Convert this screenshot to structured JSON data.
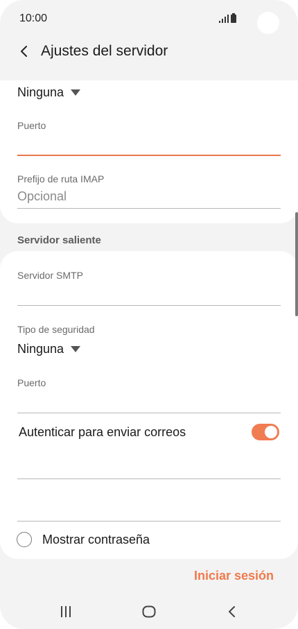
{
  "status_bar": {
    "time": "10:00"
  },
  "app_bar": {
    "title": "Ajustes del servidor"
  },
  "incoming": {
    "security_value": "Ninguna",
    "port_label": "Puerto",
    "port_value": "",
    "imap_prefix_label": "Prefijo de ruta IMAP",
    "imap_prefix_placeholder": "Opcional"
  },
  "outgoing": {
    "section_title": "Servidor saliente",
    "smtp_label": "Servidor SMTP",
    "smtp_value": "",
    "security_type_label": "Tipo de seguridad",
    "security_value": "Ninguna",
    "port_label": "Puerto",
    "port_value": "",
    "auth_label": "Autenticar para enviar correos",
    "auth_enabled": true,
    "username_value": "",
    "password_value": "",
    "show_password_label": "Mostrar contraseña",
    "show_password_checked": false
  },
  "actions": {
    "signin_label": "Iniciar sesión"
  },
  "colors": {
    "accent": "#ef7a4d",
    "background": "#f3f3f3",
    "card": "#ffffff"
  },
  "icons": {
    "back": "chevron-left-icon",
    "signal": "signal-icon",
    "battery": "battery-icon",
    "dropdown": "triangle-down-icon",
    "nav_recent": "recent-apps-icon",
    "nav_home": "home-icon",
    "nav_back": "back-icon"
  }
}
